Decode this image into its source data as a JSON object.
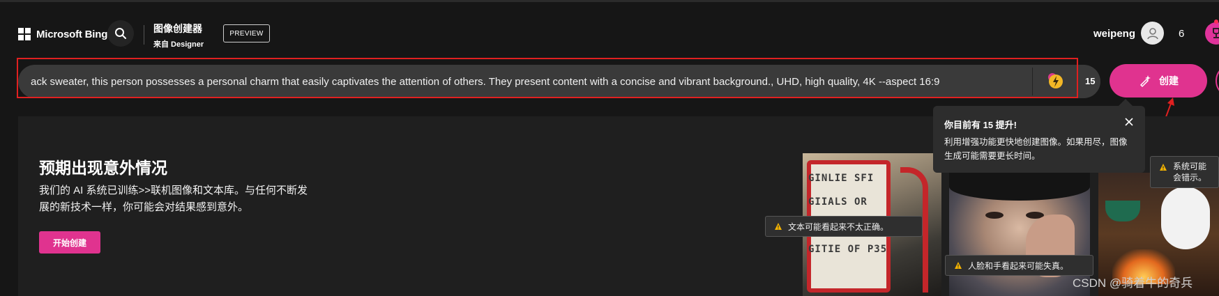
{
  "header": {
    "logo_text": "Microsoft Bing",
    "product_title": "图像创建器",
    "product_subtitle": "来自 Designer",
    "preview_label": "PREVIEW",
    "username": "weipeng",
    "rewards_count": "6"
  },
  "prompt": {
    "value": "ack sweater, this person possesses a personal charm that easily captivates the attention of others. They present content with a concise and vibrant background., UHD, high quality, 4K --aspect 16:9",
    "boosts": "15",
    "create_label": "创建"
  },
  "tooltip": {
    "title": "你目前有 15 提升!",
    "body": "利用增强功能更快地创建图像。如果用尽，图像生成可能需要更长时间。"
  },
  "card": {
    "title": "预期出现意外情况",
    "body": "我们的 AI 系统已训练>>联机图像和文本库。与任何不断发展的新技术一样，你可能会对结果感到意外。",
    "start_label": "开始创建"
  },
  "images": {
    "gas_pump_lines": [
      "GINLIE SFI",
      "GIIALS OR",
      "GITIE OF P35"
    ],
    "warnings": {
      "text": "文本可能看起来不太正确。",
      "face_hands": "人脸和手看起来可能失真。",
      "system": "系统可能会错示。"
    }
  },
  "watermark": "CSDN @骑着牛的奇兵",
  "colors": {
    "accent": "#e0338f",
    "background": "#161616",
    "highlight_box": "#e02020"
  },
  "icons": {
    "search": "search-icon",
    "avatar": "user-avatar-icon",
    "rewards": "trophy-icon",
    "boost": "lightning-boost-icon",
    "create": "magic-brush-icon",
    "close": "close-icon",
    "warning": "warning-icon"
  }
}
